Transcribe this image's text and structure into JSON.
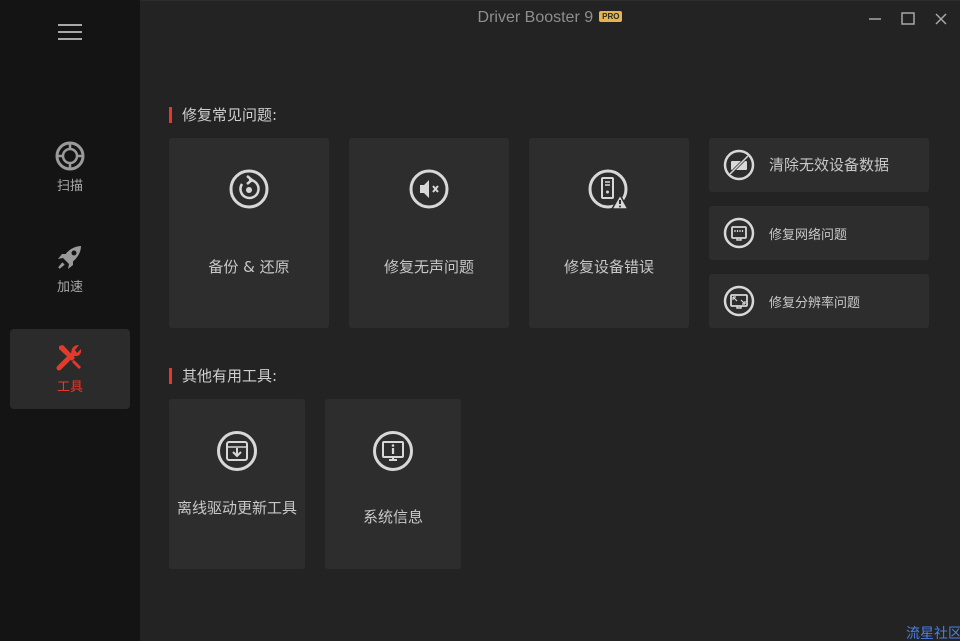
{
  "app": {
    "title": "Driver Booster 9",
    "badge": "PRO"
  },
  "sidebar": {
    "items": [
      {
        "label": "扫描",
        "icon": "scan-icon"
      },
      {
        "label": "加速",
        "icon": "rocket-icon"
      },
      {
        "label": "工具",
        "icon": "tools-icon",
        "active": true
      }
    ]
  },
  "sections": {
    "fix": {
      "title": "修复常见问题:",
      "cards": [
        {
          "label": "备份 & 还原",
          "icon": "backup-restore-icon"
        },
        {
          "label": "修复无声问题",
          "icon": "sound-mute-icon"
        },
        {
          "label": "修复设备错误",
          "icon": "device-error-icon"
        }
      ],
      "side_cards": [
        {
          "label": "清除无效设备数据",
          "icon": "clear-device-data-icon"
        },
        {
          "label": "修复网络问题",
          "icon": "network-icon"
        },
        {
          "label": "修复分辨率问题",
          "icon": "resolution-icon"
        }
      ]
    },
    "other": {
      "title": "其他有用工具:",
      "cards": [
        {
          "label": "离线驱动更新工具",
          "icon": "offline-update-icon"
        },
        {
          "label": "系统信息",
          "icon": "system-info-icon"
        }
      ]
    }
  },
  "watermark": "流星社区",
  "colors": {
    "accent": "#e8382b",
    "badge": "#e6b44a",
    "card_bg": "#2d2d2d",
    "sidebar_bg": "#141414"
  }
}
